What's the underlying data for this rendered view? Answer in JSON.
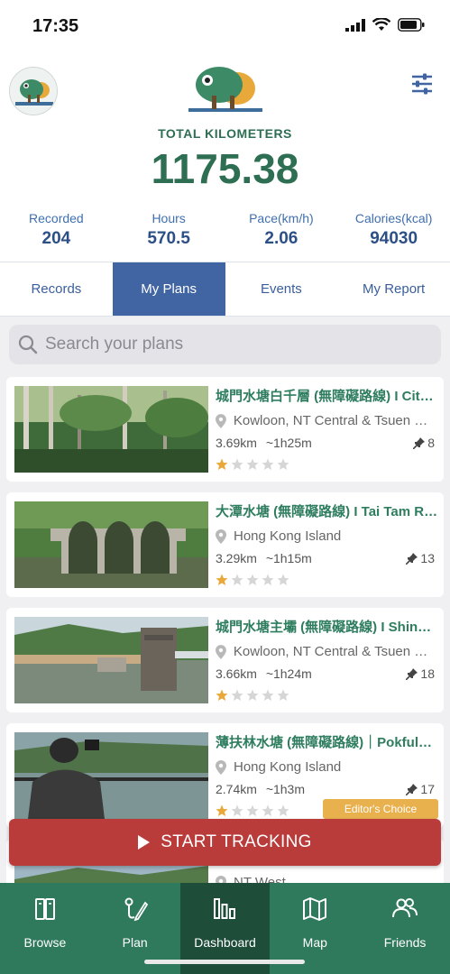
{
  "status_bar": {
    "time": "17:35"
  },
  "header": {
    "total_label": "TOTAL KILOMETERS",
    "total_value": "1175.38",
    "stats": [
      {
        "label": "Recorded",
        "value": "204"
      },
      {
        "label": "Hours",
        "value": "570.5"
      },
      {
        "label": "Pace(km/h)",
        "value": "2.06"
      },
      {
        "label": "Calories(kcal)",
        "value": "94030"
      }
    ]
  },
  "tabs": [
    {
      "label": "Records",
      "active": false
    },
    {
      "label": "My Plans",
      "active": true
    },
    {
      "label": "Events",
      "active": false
    },
    {
      "label": "My Report",
      "active": false
    }
  ],
  "search": {
    "placeholder": "Search your plans"
  },
  "plans": [
    {
      "title": "城門水塘白千層 (無障礙路線) I City Gate Reservoir",
      "location": "Kowloon, NT Central & Tsuen Wan",
      "distance": "3.69km",
      "duration": "~1h25m",
      "pins": "8",
      "rating": 1,
      "editors_choice": false
    },
    {
      "title": "大潭水塘 (無障礙路線) I Tai Tam Reservoir",
      "location": "Hong Kong Island",
      "distance": "3.29km",
      "duration": "~1h15m",
      "pins": "13",
      "rating": 1,
      "editors_choice": false
    },
    {
      "title": "城門水塘主壩  (無障礙路線) I Shing Mun Main Dam",
      "location": "Kowloon, NT Central & Tsuen Wan",
      "distance": "3.66km",
      "duration": "~1h24m",
      "pins": "18",
      "rating": 1,
      "editors_choice": false
    },
    {
      "title": "薄扶林水塘 (無障礙路線)｜Pokfulam Reservoir",
      "location": "Hong Kong Island",
      "distance": "2.74km",
      "duration": "~1h3m",
      "pins": "17",
      "rating": 1,
      "editors_choice": true,
      "badge": "Editor's Choice"
    },
    {
      "title": "",
      "location": "NT West",
      "distance": "",
      "duration": "",
      "pins": "",
      "rating": 0,
      "editors_choice": false
    }
  ],
  "start_tracking": {
    "label": "START TRACKING"
  },
  "bottom_nav": [
    {
      "label": "Browse",
      "icon": "book-icon",
      "active": false
    },
    {
      "label": "Plan",
      "icon": "route-pen-icon",
      "active": false
    },
    {
      "label": "Dashboard",
      "icon": "bar-chart-icon",
      "active": true
    },
    {
      "label": "Map",
      "icon": "map-icon",
      "active": false
    },
    {
      "label": "Friends",
      "icon": "people-icon",
      "active": false
    }
  ],
  "colors": {
    "brand_green": "#2e6e53",
    "nav_green": "#2f7a5c",
    "tab_blue": "#4164a3",
    "start_red": "#b93c3a",
    "badge_orange": "#e9b04e",
    "star_gold": "#e8a93a"
  }
}
